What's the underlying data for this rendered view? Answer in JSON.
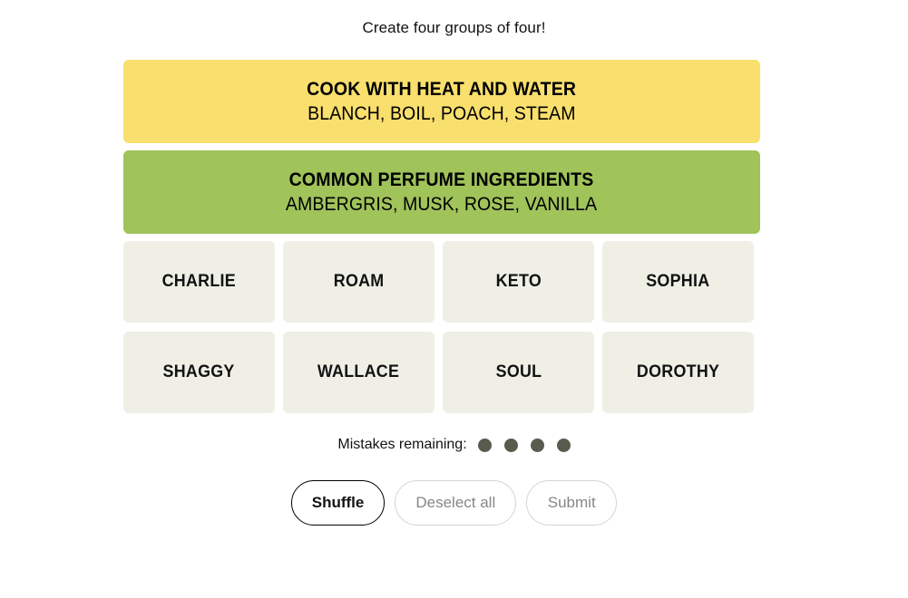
{
  "page": {
    "title": "Create four groups of four!"
  },
  "solved_groups": [
    {
      "category": "COOK WITH HEAT AND WATER",
      "members": "BLANCH, BOIL, POACH, STEAM",
      "color": "#f9df6d",
      "color_name": "yellow"
    },
    {
      "category": "COMMON PERFUME INGREDIENTS",
      "members": "AMBERGRIS, MUSK, ROSE, VANILLA",
      "color": "#a0c35a",
      "color_name": "green"
    }
  ],
  "tiles": {
    "rows": [
      [
        "CHARLIE",
        "ROAM",
        "KETO",
        "SOPHIA"
      ],
      [
        "SHAGGY",
        "WALLACE",
        "SOUL",
        "DOROTHY"
      ]
    ],
    "background": "#efefe6"
  },
  "mistakes": {
    "label": "Mistakes remaining:",
    "remaining": 4,
    "dot_color": "#5a5a4e"
  },
  "actions": {
    "shuffle_label": "Shuffle",
    "deselect_label": "Deselect all",
    "submit_label": "Submit"
  }
}
